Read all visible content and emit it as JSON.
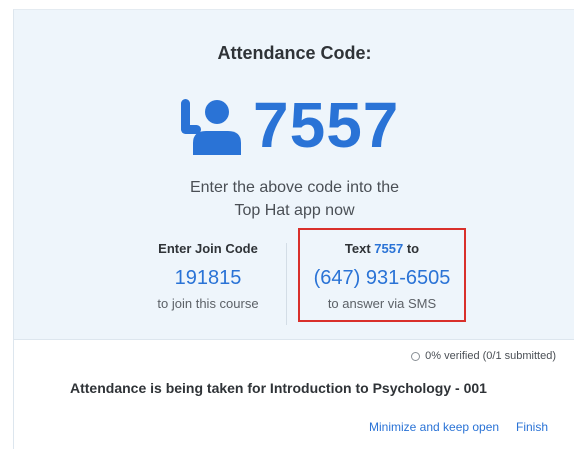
{
  "header": {
    "title": "Attendance Code:"
  },
  "code": {
    "icon": "raised-hand-user-icon",
    "value": "7557"
  },
  "instructions": {
    "line1": "Enter the above code into the",
    "line2": "Top Hat app now"
  },
  "join": {
    "label": "Enter Join Code",
    "code": "191815",
    "sub": "to join this course"
  },
  "sms": {
    "label_prefix": "Text ",
    "label_code": "7557",
    "label_suffix": " to",
    "phone": "(647) 931-6505",
    "sub": "to answer via SMS"
  },
  "status": {
    "verified": "0% verified (0/1 submitted)"
  },
  "footer": {
    "message": "Attendance is being taken for Introduction to Psychology - 001",
    "minimize_label": "Minimize and keep open",
    "finish_label": "Finish"
  },
  "colors": {
    "accent": "#2a73d6",
    "highlight_border": "#d9302b",
    "panel_bg": "#eef5fb"
  }
}
